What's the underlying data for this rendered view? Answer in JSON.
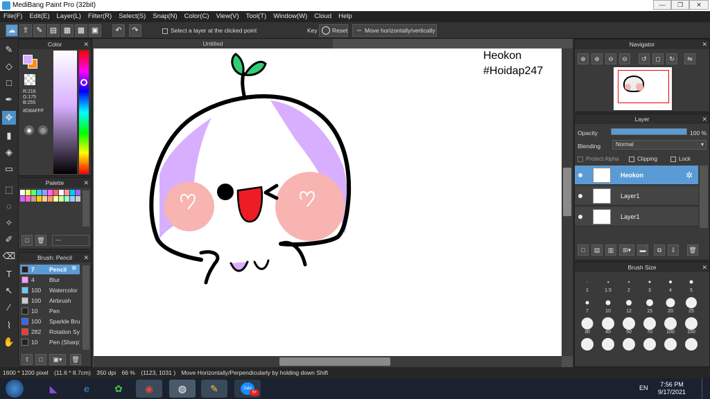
{
  "window": {
    "title": "MediBang Paint Pro (32bit)",
    "minimize": "—",
    "restore": "❐",
    "close": "✕"
  },
  "menu": [
    "File(F)",
    "Edit(E)",
    "Layer(L)",
    "Filter(R)",
    "Select(S)",
    "Snap(N)",
    "Color(C)",
    "View(V)",
    "Tool(T)",
    "Window(W)",
    "Cloud",
    "Help"
  ],
  "toolbar": {
    "select_layer_label": "Select a layer at the clicked point",
    "key_label": "Key",
    "reset_label": "Reset",
    "move_label": "Move horizontally/vertically"
  },
  "color_panel": {
    "title": "Color",
    "r": "R:216",
    "g": "G:175",
    "b": "B:255",
    "hex": "#D8AFFF",
    "fg_color": "#D8AFFF",
    "bg_color": "#FF8C1A"
  },
  "palette_panel": {
    "title": "Palette",
    "swatches": [
      "#ffffff",
      "#ffff66",
      "#66ff66",
      "#33ccff",
      "#9999ff",
      "#ff66ff",
      "#ff6666",
      "#ffffff",
      "#ff9999",
      "#00ccff",
      "#9966ff",
      "#cc66ff",
      "#ff66cc",
      "#cc9999",
      "#ffcc00",
      "#ffcc99",
      "#ff9966",
      "#ffff99",
      "#ccff99",
      "#99ffcc",
      "#99ccff",
      "#cccccc"
    ],
    "dash_label": "---"
  },
  "brush_panel": {
    "title": "Brush: Pencil",
    "items": [
      {
        "size": "7",
        "name": "Pencil",
        "color": "#222222",
        "selected": true
      },
      {
        "size": "4",
        "name": "Blur",
        "color": "#ff99ff",
        "selected": false
      },
      {
        "size": "100",
        "name": "Watercolor",
        "color": "#66ccff",
        "selected": false
      },
      {
        "size": "100",
        "name": "Airbrush",
        "color": "#cccccc",
        "selected": false
      },
      {
        "size": "10",
        "name": "Pen",
        "color": "#222222",
        "selected": false
      },
      {
        "size": "100",
        "name": "Sparkle Brush",
        "color": "#3366ff",
        "selected": false
      },
      {
        "size": "282",
        "name": "Rotation Sym",
        "color": "#ff3333",
        "selected": false
      },
      {
        "size": "10",
        "name": "Pen (Sharp)",
        "color": "#222222",
        "selected": false
      }
    ]
  },
  "document": {
    "tab_title": "Untitled",
    "text_line1": "Heokon",
    "text_line2": "#Hoidap247"
  },
  "navigator": {
    "title": "Navigator"
  },
  "layer_panel": {
    "title": "Layer",
    "opacity_label": "Opacity",
    "opacity_value": "100 %",
    "opacity_fraction": 1.0,
    "blending_label": "Blending",
    "blending_value": "Normal",
    "protect_alpha": "Protect Alpha",
    "clipping": "Clipping",
    "lock": "Lock",
    "layers": [
      {
        "name": "Heokon",
        "selected": true
      },
      {
        "name": "Layer1",
        "selected": false
      },
      {
        "name": "Layer1",
        "selected": false
      }
    ]
  },
  "brush_size_panel": {
    "title": "Brush Size",
    "sizes": [
      "1",
      "1.5",
      "2",
      "3",
      "4",
      "5",
      "7",
      "10",
      "12",
      "15",
      "20",
      "25",
      "30",
      "40",
      "50",
      "70",
      "100",
      "150",
      "",
      "",
      "",
      "",
      "",
      ""
    ]
  },
  "status": {
    "pixels": "1600 * 1200 pixel",
    "cm": "(11.6 * 8.7cm)",
    "dpi": "350 dpi",
    "zoom": "66 %",
    "coords": "(1123, 1031 )",
    "hint": "Move Horizontally/Perpendicularly by holding down Shift"
  },
  "taskbar": {
    "lang": "EN",
    "time": "7:56 PM",
    "date": "9/17/2021",
    "zalo_label": "Zalo",
    "zalo_badge": "5+"
  }
}
